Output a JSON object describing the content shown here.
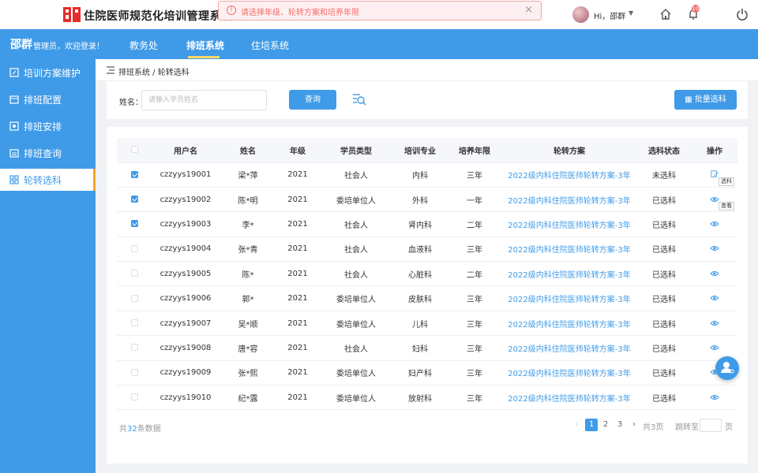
{
  "header": {
    "title": "住院医师规范化培训管理系统",
    "alert": "请选择年级、轮转方案和培养年限",
    "alert_close": "×",
    "greeting": "Hi，邵群",
    "user_caret": "▼",
    "bell_count": "10"
  },
  "nav": {
    "brand": "邵群",
    "welcome": "管理员，欢迎登录！",
    "tabs": [
      {
        "label": "教务处"
      },
      {
        "label": "排班系统"
      },
      {
        "label": "住培系统"
      }
    ]
  },
  "sidebar": {
    "items": [
      {
        "label": "培训方案维护"
      },
      {
        "label": "排班配置"
      },
      {
        "label": "排班安排"
      },
      {
        "label": "排班查询"
      },
      {
        "label": "轮转选科"
      }
    ]
  },
  "breadcrumb": "排班系统 / 轮转选科",
  "search": {
    "label": "姓名：",
    "placeholder": "请输入学员姓名",
    "query_button": "查询",
    "batch_button": "批量选科"
  },
  "table": {
    "headers": [
      "用户名",
      "姓名",
      "年级",
      "学员类型",
      "培训专业",
      "培养年限",
      "轮转方案",
      "选科状态",
      "操作"
    ],
    "rows": [
      {
        "checked": true,
        "username": "czzyys19001",
        "name": "梁*萍",
        "grade": "2021",
        "type": "社会人",
        "major": "内科",
        "years": "三年",
        "plan": "2022级内科住院医师轮转方案-3年",
        "status": "未选科"
      },
      {
        "checked": true,
        "username": "czzyys19002",
        "name": "陈*明",
        "grade": "2021",
        "type": "委培单位人",
        "major": "外科",
        "years": "一年",
        "plan": "2022级内科住院医师轮转方案-3年",
        "status": "已选科"
      },
      {
        "checked": true,
        "username": "czzyys19003",
        "name": "李*",
        "grade": "2021",
        "type": "社会人",
        "major": "肾内科",
        "years": "二年",
        "plan": "2022级内科住院医师轮转方案-3年",
        "status": "已选科"
      },
      {
        "checked": false,
        "username": "czzyys19004",
        "name": "张*青",
        "grade": "2021",
        "type": "社会人",
        "major": "血液科",
        "years": "三年",
        "plan": "2022级内科住院医师轮转方案-3年",
        "status": "已选科"
      },
      {
        "checked": false,
        "username": "czzyys19005",
        "name": "陈*",
        "grade": "2021",
        "type": "社会人",
        "major": "心脏科",
        "years": "二年",
        "plan": "2022级内科住院医师轮转方案-3年",
        "status": "已选科"
      },
      {
        "checked": false,
        "username": "czzyys19006",
        "name": "郭*",
        "grade": "2021",
        "type": "委培单位人",
        "major": "皮肤科",
        "years": "三年",
        "plan": "2022级内科住院医师轮转方案-3年",
        "status": "已选科"
      },
      {
        "checked": false,
        "username": "czzyys19007",
        "name": "吴*顺",
        "grade": "2021",
        "type": "委培单位人",
        "major": "儿科",
        "years": "三年",
        "plan": "2022级内科住院医师轮转方案-3年",
        "status": "已选科"
      },
      {
        "checked": false,
        "username": "czzyys19008",
        "name": "唐*容",
        "grade": "2021",
        "type": "社会人",
        "major": "妇科",
        "years": "三年",
        "plan": "2022级内科住院医师轮转方案-3年",
        "status": "已选科"
      },
      {
        "checked": false,
        "username": "czzyys19009",
        "name": "张*熙",
        "grade": "2021",
        "type": "委培单位人",
        "major": "妇产科",
        "years": "三年",
        "plan": "2022级内科住院医师轮转方案-3年",
        "status": "已选科"
      },
      {
        "checked": false,
        "username": "czzyys19010",
        "name": "纪*露",
        "grade": "2021",
        "type": "委培单位人",
        "major": "放射科",
        "years": "三年",
        "plan": "2022级内科住院医师轮转方案-3年",
        "status": "已选科"
      }
    ],
    "tooltips": {
      "select": "选科",
      "view": "查看"
    }
  },
  "footer": {
    "total_prefix": "共",
    "total_count": "32",
    "total_suffix": "条数据",
    "pages": [
      "1",
      "2",
      "3"
    ],
    "page_total": "共3页",
    "jump_label": "跳转至",
    "page_unit": "页",
    "prev": "‹",
    "next": "›"
  },
  "colors": {
    "primary": "#3f9be8",
    "accent": "#f5a623",
    "alert": "#f56c6c"
  }
}
